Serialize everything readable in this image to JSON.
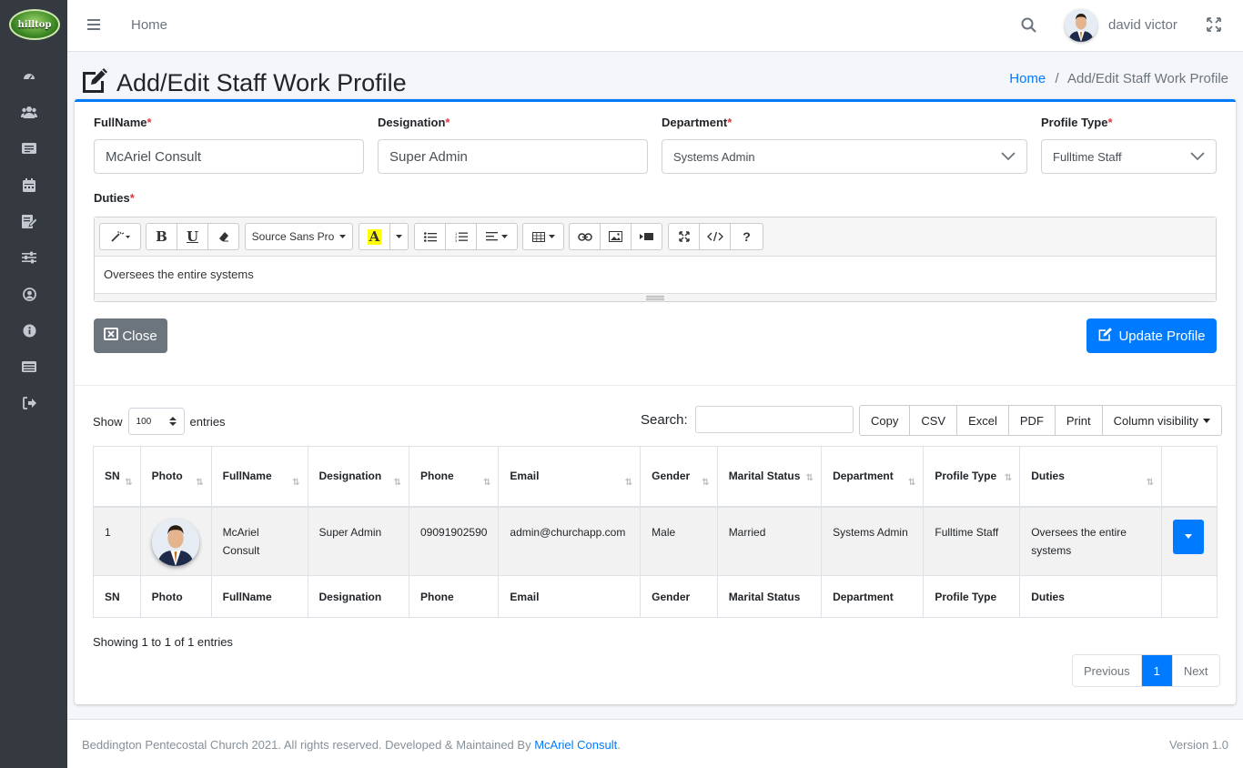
{
  "brand": {
    "logo_text": "hilltop"
  },
  "topbar": {
    "home": "Home",
    "user_name": "david victor"
  },
  "page": {
    "title": "Add/Edit Staff Work Profile",
    "breadcrumb_home": "Home",
    "breadcrumb_sep": "/",
    "breadcrumb_current": "Add/Edit Staff Work Profile"
  },
  "form": {
    "fullname_label": "FullName",
    "fullname_value": "McAriel Consult",
    "designation_label": "Designation",
    "designation_value": "Super Admin",
    "department_label": "Department",
    "department_value": "Systems Admin",
    "profile_type_label": "Profile Type",
    "profile_type_value": "Fulltime Staff",
    "duties_label": "Duties",
    "required_mark": "*",
    "editor_font": "Source Sans Pro",
    "duties_value": "Oversees the entire systems",
    "close_label": "Close",
    "update_label": "Update Profile"
  },
  "datatable": {
    "show_label": "Show",
    "entries_label": "entries",
    "page_length": "100",
    "search_label": "Search:",
    "buttons": [
      "Copy",
      "CSV",
      "Excel",
      "PDF",
      "Print",
      "Column visibility"
    ],
    "columns": [
      "SN",
      "Photo",
      "FullName",
      "Designation",
      "Phone",
      "Email",
      "Gender",
      "Marital Status",
      "Department",
      "Profile Type",
      "Duties"
    ],
    "row": {
      "sn": "1",
      "fullname": "McAriel Consult",
      "designation": "Super Admin",
      "phone": "09091902590",
      "email": "admin@churchapp.com",
      "gender": "Male",
      "marital": "Married",
      "department": "Systems Admin",
      "profile_type": "Fulltime Staff",
      "duties": "Oversees the entire systems"
    },
    "info": "Showing 1 to 1 of 1 entries",
    "pager": {
      "prev": "Previous",
      "current": "1",
      "next": "Next"
    }
  },
  "footer": {
    "text": "Beddington Pentecostal Church 2021. All rights reserved. Developed & Maintained By ",
    "link": "McAriel Consult",
    "period": ".",
    "version": "Version 1.0"
  }
}
